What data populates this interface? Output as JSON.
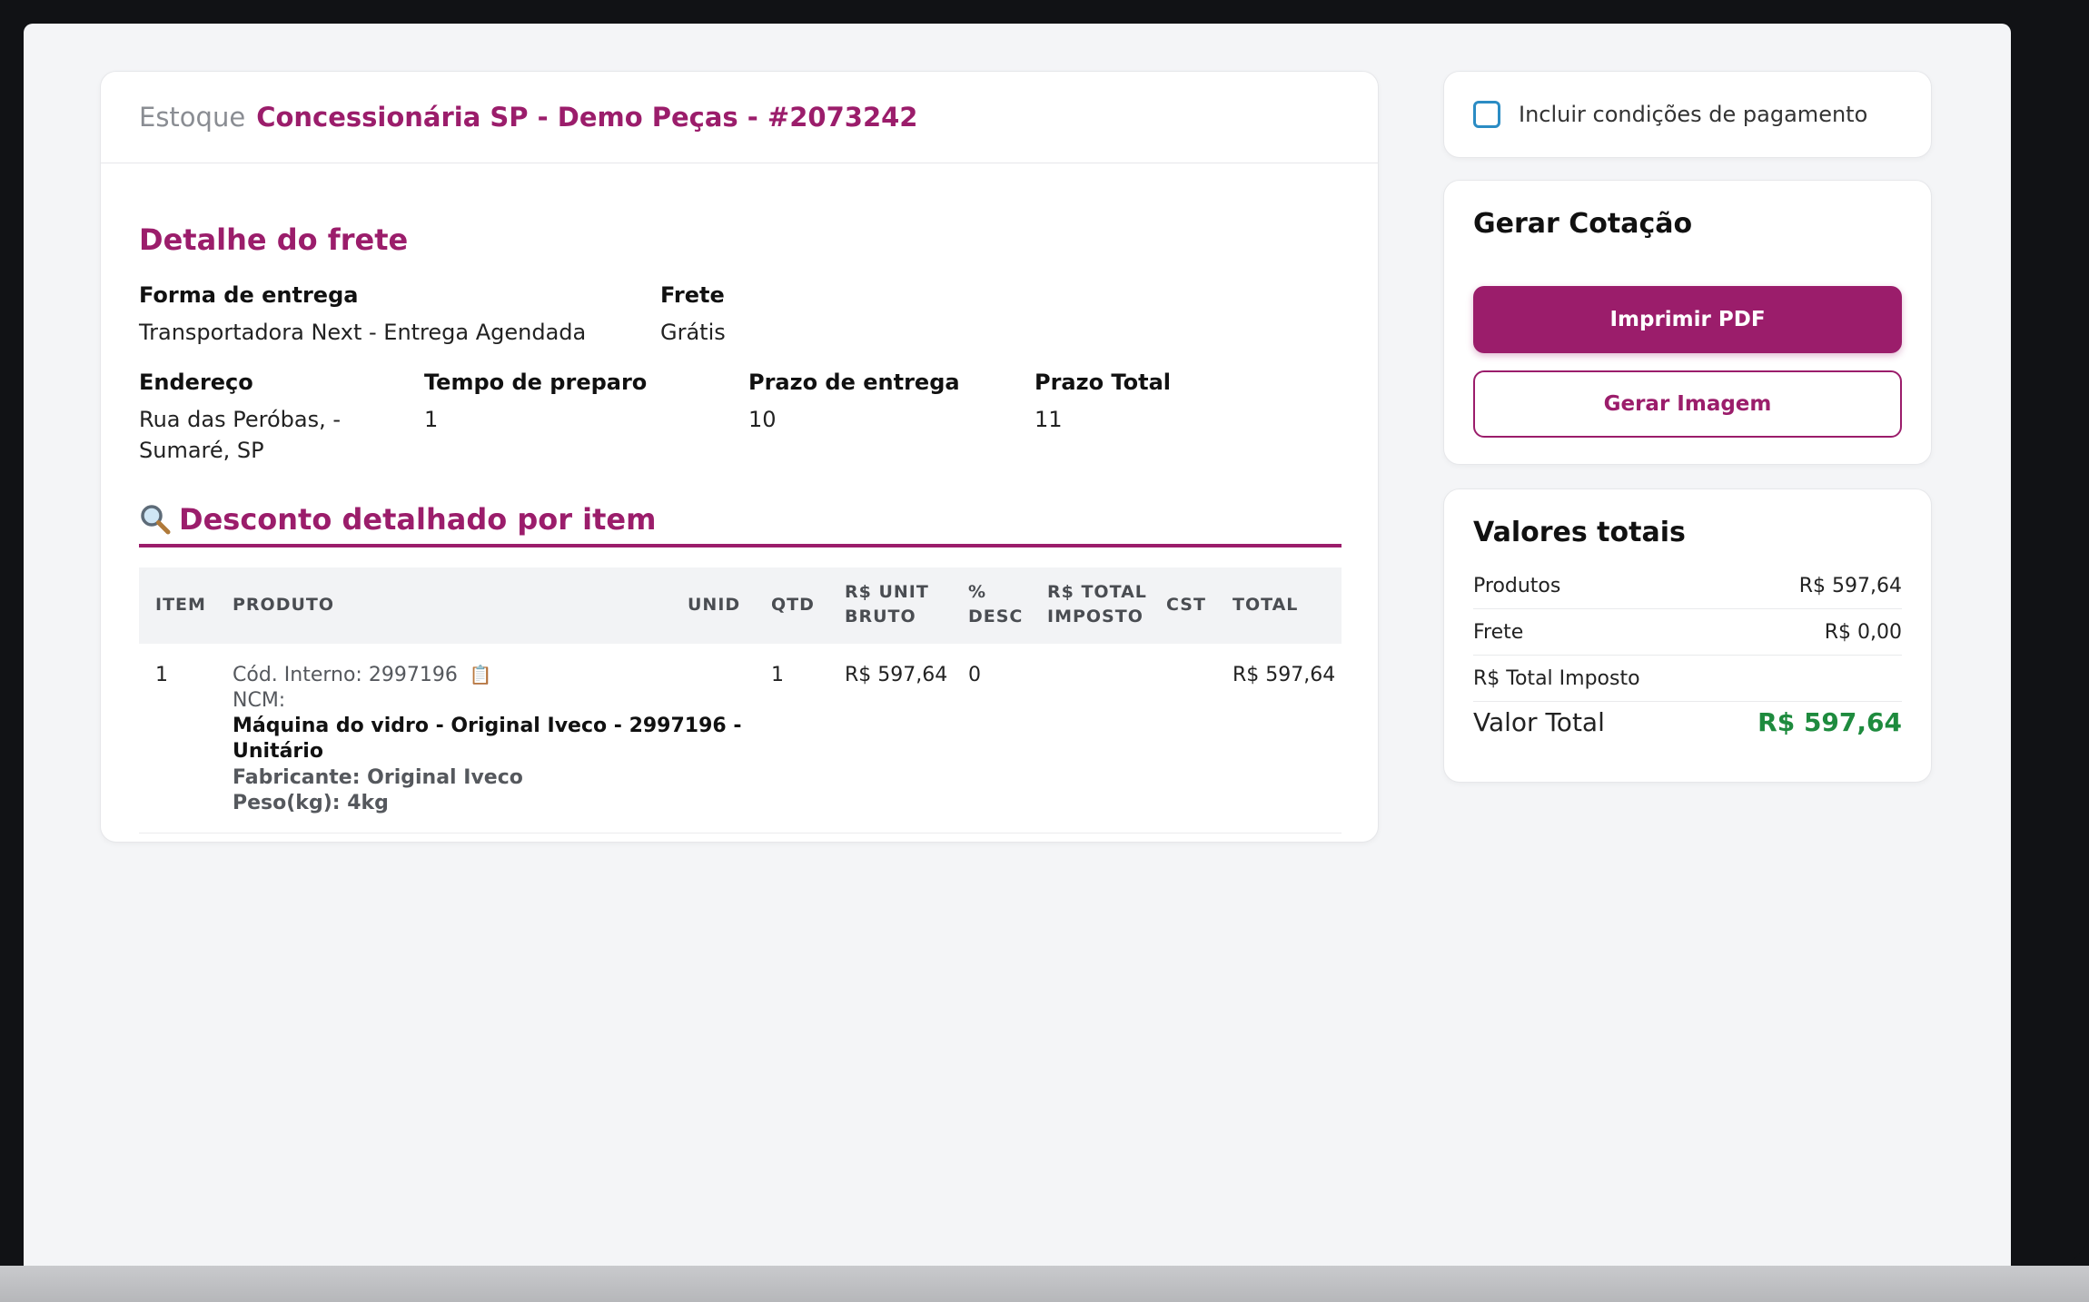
{
  "header": {
    "label": "Estoque",
    "title": "Concessionária SP - Demo Peças - #2073242"
  },
  "freight": {
    "section_title": "Detalhe do frete",
    "delivery_method_label": "Forma de entrega",
    "delivery_method_value": "Transportadora Next - Entrega Agendada",
    "freight_label": "Frete",
    "freight_value": "Grátis",
    "address_label": "Endereço",
    "address_line1": "Rua das Peróbas, -",
    "address_line2": "Sumaré, SP",
    "prep_time_label": "Tempo de preparo",
    "prep_time_value": "1",
    "delivery_time_label": "Prazo de entrega",
    "delivery_time_value": "10",
    "total_time_label": "Prazo Total",
    "total_time_value": "11"
  },
  "discount": {
    "section_icon": "magnifier-icon",
    "section_title": "Desconto detalhado por item",
    "columns": {
      "item": "ITEM",
      "product": "PRODUTO",
      "unit": "UNID",
      "qty": "QTD",
      "unit_gross_1": "R$ UNIT",
      "unit_gross_2": "BRUTO",
      "disc_1": "%",
      "disc_2": "DESC",
      "total_tax_1": "R$ TOTAL",
      "total_tax_2": "IMPOSTO",
      "cst": "CST",
      "total": "TOTAL"
    },
    "rows": [
      {
        "item": "1",
        "code_label": "Cód. Interno:",
        "code_value": "2997196",
        "ncm_label": "NCM:",
        "name_line1": "Máquina do vidro - Original Iveco - 2997196 -",
        "name_line2": "Unitário",
        "manufacturer": "Fabricante: Original Iveco",
        "weight": "Peso(kg): 4kg",
        "unit": "",
        "qty": "1",
        "unit_gross": "R$ 597,64",
        "disc": "0",
        "total_tax": "",
        "cst": "",
        "total": "R$ 597,64"
      }
    ]
  },
  "payment": {
    "checkbox_label": "Incluir condições de pagamento",
    "checked": false
  },
  "quote": {
    "title": "Gerar Cotação",
    "print_pdf_label": "Imprimir PDF",
    "generate_image_label": "Gerar Imagem"
  },
  "totals": {
    "title": "Valores totais",
    "products_label": "Produtos",
    "products_value": "R$ 597,64",
    "freight_label": "Frete",
    "freight_value": "R$ 0,00",
    "tax_label": "R$ Total Imposto",
    "tax_value": "",
    "total_label": "Valor Total",
    "total_value": "R$ 597,64"
  },
  "colors": {
    "brand": "#9b1d6b",
    "success": "#1e8b3e",
    "checkbox_border": "#2b8cc4"
  }
}
